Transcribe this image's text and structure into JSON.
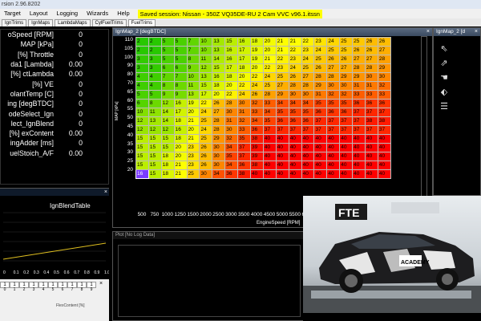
{
  "window": {
    "title": "rsion 2.96.8202"
  },
  "menu": {
    "items": [
      "Target",
      "Layout",
      "Logging",
      "Wizards",
      "Help"
    ],
    "session": "Saved session: Nissan - 350Z VQ35DE-RU 2 Cam VVC v96.1.itssn"
  },
  "tabs": [
    "IgnTrims",
    "IgnMaps",
    "LambdaMaps",
    "CylFuelTrims",
    "FuelTrims"
  ],
  "gauges": [
    {
      "label": "oSpeed [RPM]",
      "value": "0"
    },
    {
      "label": "MAP [kPa]",
      "value": "0"
    },
    {
      "label": "Throttle [%]",
      "value": "0"
    },
    {
      "label": "da1 [Lambda]",
      "value": "0.00"
    },
    {
      "label": "ctLambda [%]",
      "value": "0.00"
    },
    {
      "label": "VE [%]",
      "value": "0"
    },
    {
      "label": "olantTemp [C]",
      "value": "0"
    },
    {
      "label": "ing [degBTDC]",
      "value": "0"
    },
    {
      "label": "odeSelect_Ign",
      "value": "0"
    },
    {
      "label": "lect_IgnBlend",
      "value": "0"
    },
    {
      "label": "exContent [%]",
      "value": "0.00"
    },
    {
      "label": "ingAdder [ms]",
      "value": "0"
    },
    {
      "label": "uelStoich_A/F",
      "value": "0.00"
    }
  ],
  "blend": {
    "title": "IgnBlendTable",
    "yticks": [
      "1",
      "0.8",
      "0.6",
      "0.4",
      "0.2",
      "0"
    ],
    "xticks": [
      "0",
      "0.1",
      "0.2",
      "0.3",
      "0.4",
      "0.5",
      "0.6",
      "0.7",
      "0.8",
      "0.9",
      "1.0"
    ],
    "close": "×"
  },
  "bottom_table": {
    "values": [
      "1",
      "1",
      "1",
      "1",
      "1",
      "1",
      "1",
      "1",
      "1",
      "1"
    ],
    "labels": [
      "0",
      "1",
      "2",
      "3",
      "4",
      "5",
      "6",
      "7",
      "8",
      "9"
    ],
    "footer": "FlexContent [%]",
    "close": "×"
  },
  "ignmap": {
    "title": "IgnMap_2 [degBTDC]",
    "close": "×",
    "xlabel": "EngineSpeed [RPM]",
    "ylabel": "MAP [kPa]",
    "cols": [
      "500",
      "750",
      "1000",
      "1250",
      "1500",
      "2000",
      "2500",
      "3000",
      "3500",
      "4000",
      "4500",
      "5000",
      "5500",
      "6000",
      "6500",
      "7000",
      "7500",
      "8000",
      "8500",
      "9000"
    ],
    "rows": [
      {
        "map": "110",
        "cells": [
          "2",
          "2",
          "5",
          "5",
          "7",
          "10",
          "13",
          "15",
          "16",
          "18",
          "20",
          "21",
          "21",
          "22",
          "23",
          "24",
          "25",
          "25",
          "26",
          "26"
        ]
      },
      {
        "map": "105",
        "cells": [
          "2",
          "2",
          "5",
          "5",
          "7",
          "10",
          "13",
          "16",
          "17",
          "19",
          "20",
          "21",
          "22",
          "23",
          "24",
          "25",
          "25",
          "26",
          "26",
          "27"
        ]
      },
      {
        "map": "100",
        "cells": [
          "3",
          "3",
          "5",
          "5",
          "8",
          "11",
          "14",
          "16",
          "17",
          "19",
          "21",
          "22",
          "23",
          "24",
          "25",
          "26",
          "26",
          "27",
          "27",
          "28"
        ]
      },
      {
        "map": "90",
        "cells": [
          "3",
          "3",
          "6",
          "6",
          "9",
          "12",
          "15",
          "17",
          "18",
          "20",
          "22",
          "23",
          "24",
          "25",
          "26",
          "27",
          "27",
          "28",
          "28",
          "29"
        ]
      },
      {
        "map": "80",
        "cells": [
          "4",
          "4",
          "7",
          "7",
          "10",
          "13",
          "16",
          "18",
          "20",
          "22",
          "24",
          "25",
          "26",
          "27",
          "28",
          "28",
          "29",
          "29",
          "30",
          "30"
        ]
      },
      {
        "map": "70",
        "cells": [
          "4",
          "4",
          "8",
          "8",
          "11",
          "15",
          "18",
          "20",
          "22",
          "24",
          "25",
          "27",
          "28",
          "28",
          "29",
          "30",
          "30",
          "31",
          "31",
          "32"
        ]
      },
      {
        "map": "65",
        "cells": [
          "5",
          "5",
          "9",
          "9",
          "13",
          "17",
          "20",
          "22",
          "24",
          "26",
          "28",
          "29",
          "30",
          "30",
          "31",
          "32",
          "32",
          "33",
          "33",
          "33"
        ]
      },
      {
        "map": "60",
        "cells": [
          "6",
          "8",
          "12",
          "16",
          "19",
          "22",
          "26",
          "28",
          "30",
          "32",
          "33",
          "34",
          "34",
          "34",
          "35",
          "35",
          "35",
          "36",
          "36",
          "36"
        ]
      },
      {
        "map": "55",
        "cells": [
          "10",
          "11",
          "14",
          "17",
          "20",
          "24",
          "27",
          "30",
          "31",
          "33",
          "34",
          "35",
          "35",
          "35",
          "36",
          "36",
          "36",
          "37",
          "37",
          "37"
        ]
      },
      {
        "map": "50",
        "cells": [
          "12",
          "13",
          "14",
          "18",
          "21",
          "25",
          "28",
          "31",
          "32",
          "34",
          "35",
          "36",
          "36",
          "36",
          "37",
          "37",
          "37",
          "37",
          "38",
          "38"
        ]
      },
      {
        "map": "45",
        "cells": [
          "12",
          "12",
          "12",
          "16",
          "20",
          "24",
          "28",
          "30",
          "33",
          "36",
          "37",
          "37",
          "37",
          "37",
          "37",
          "37",
          "37",
          "37",
          "37",
          "37"
        ]
      },
      {
        "map": "40",
        "cells": [
          "15",
          "15",
          "15",
          "18",
          "21",
          "25",
          "29",
          "32",
          "35",
          "38",
          "40",
          "40",
          "40",
          "40",
          "40",
          "40",
          "40",
          "40",
          "40",
          "40"
        ]
      },
      {
        "map": "35",
        "cells": [
          "15",
          "15",
          "15",
          "20",
          "23",
          "26",
          "30",
          "34",
          "37",
          "39",
          "40",
          "40",
          "40",
          "40",
          "40",
          "40",
          "40",
          "40",
          "40",
          "40"
        ]
      },
      {
        "map": "30",
        "cells": [
          "15",
          "15",
          "18",
          "20",
          "23",
          "26",
          "30",
          "35",
          "37",
          "39",
          "40",
          "40",
          "40",
          "40",
          "40",
          "40",
          "40",
          "40",
          "40",
          "40"
        ]
      },
      {
        "map": "25",
        "cells": [
          "15",
          "15",
          "18",
          "21",
          "23",
          "26",
          "30",
          "34",
          "36",
          "38",
          "40",
          "40",
          "40",
          "40",
          "40",
          "40",
          "40",
          "40",
          "40",
          "40"
        ]
      },
      {
        "map": "20",
        "cells": [
          "16",
          "15",
          "18",
          "21",
          "25",
          "30",
          "34",
          "36",
          "38",
          "40",
          "40",
          "40",
          "40",
          "40",
          "40",
          "40",
          "40",
          "40",
          "40",
          "40"
        ]
      }
    ]
  },
  "toolpanel": {
    "title": "IgnMap_2 [d",
    "close": "×",
    "tools": [
      "⇖",
      "⇗",
      "☚",
      "⬖",
      "☰"
    ]
  },
  "plot": {
    "title": "Plot [No Log Data]"
  },
  "photo": {
    "banner": "FTE",
    "car_text": "ACADEMY"
  },
  "colors": {
    "accent": "#ffff00"
  }
}
